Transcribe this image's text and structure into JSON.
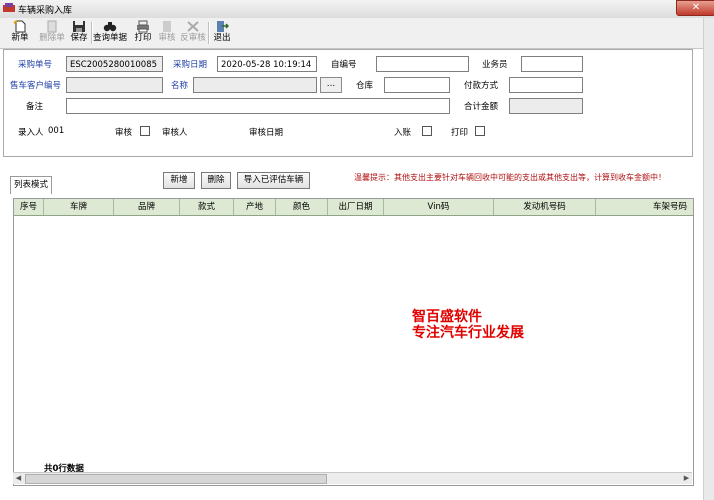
{
  "window": {
    "title": "车辆采购入库",
    "close_glyph": "✕"
  },
  "toolbar": {
    "buttons": [
      {
        "label": "新单",
        "icon": "new-doc-icon",
        "enabled": true
      },
      {
        "label": "删除单",
        "icon": "delete-doc-icon",
        "enabled": false
      },
      {
        "label": "保存",
        "icon": "save-icon",
        "enabled": true
      },
      {
        "label": "查询单据",
        "icon": "binoculars-icon",
        "enabled": true
      },
      {
        "label": "打印",
        "icon": "printer-icon",
        "enabled": true
      },
      {
        "label": "审核",
        "icon": "audit-icon",
        "enabled": false
      },
      {
        "label": "反审核",
        "icon": "unaudit-icon",
        "enabled": false
      },
      {
        "label": "退出",
        "icon": "exit-icon",
        "enabled": true
      }
    ]
  },
  "form": {
    "purchase_no_label": "采购单号",
    "purchase_no_value": "ESC2005280010085",
    "purchase_date_label": "采购日期",
    "purchase_date_value": "2020-05-28 10:19:14",
    "self_no_label": "自编号",
    "self_no_value": "",
    "salesman_label": "业务员",
    "salesman_value": "",
    "seller_customer_label": "售车客户编号",
    "seller_customer_value": "",
    "name_label": "名称",
    "name_value": "",
    "lookup_button": "...",
    "warehouse_label": "仓库",
    "warehouse_value": "",
    "payment_label": "付款方式",
    "payment_value": "",
    "remark_label": "备注",
    "remark_value": "",
    "total_label": "合计金额",
    "total_value": "",
    "entered_by_label": "录入人",
    "entered_by_value": "001",
    "audit_label": "审核",
    "auditor_label": "审核人",
    "audit_date_label": "审核日期",
    "posted_label": "入账",
    "print_label": "打印"
  },
  "tab": {
    "label": "列表模式"
  },
  "actions": {
    "add": "新增",
    "delete": "删除",
    "import": "导入已评估车辆"
  },
  "hint": "温馨提示：其他支出主要针对车辆回收中可能的支出或其他支出等，计算到收车金额中！",
  "grid": {
    "columns": [
      "序号",
      "车牌",
      "品牌",
      "款式",
      "产地",
      "颜色",
      "出厂日期",
      "Vin码",
      "发动机号码",
      "车架号码"
    ],
    "rows": [],
    "row_count_text": "共0行数据"
  },
  "watermark": {
    "line1": "智百盛软件",
    "line2": "专注汽车行业发展"
  },
  "colors": {
    "accent_red": "#e00000",
    "label_blue": "#1f3fa6",
    "grid_header": "#dde9d3"
  }
}
